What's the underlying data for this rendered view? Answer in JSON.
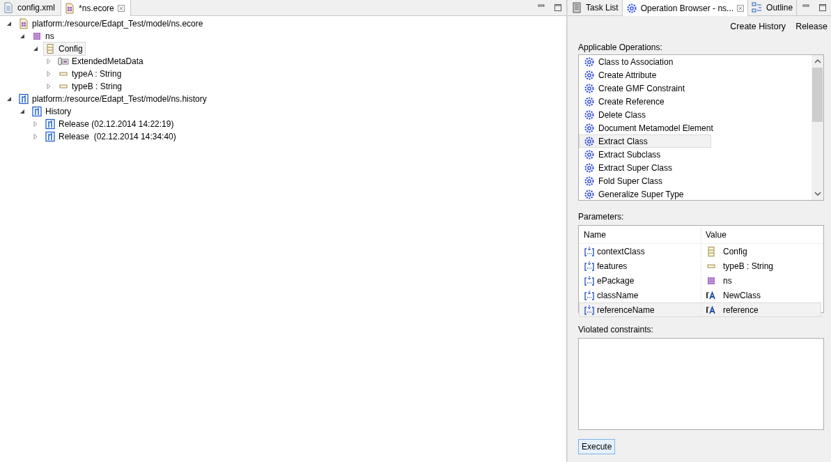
{
  "editor_tabs": [
    {
      "label": "config.xml",
      "kind": "xml",
      "selected": false,
      "closable": false
    },
    {
      "label": "*ns.ecore",
      "kind": "ecore",
      "selected": true,
      "closable": true
    }
  ],
  "tree": [
    {
      "label": "platform:/resource/Edapt_Test/model/ns.ecore",
      "kind": "resource",
      "expanded": true,
      "selected": false,
      "children": [
        {
          "label": "ns",
          "kind": "package",
          "expanded": true,
          "selected": false,
          "children": [
            {
              "label": "Config",
              "kind": "class",
              "expanded": true,
              "selected": true,
              "children": [
                {
                  "label": "ExtendedMetaData",
                  "kind": "annotation",
                  "expanded": false,
                  "selected": false
                },
                {
                  "label": "typeA : String",
                  "kind": "attribute",
                  "expanded": false,
                  "selected": false
                },
                {
                  "label": "typeB : String",
                  "kind": "attribute",
                  "expanded": false,
                  "selected": false
                }
              ]
            }
          ]
        }
      ]
    },
    {
      "label": "platform:/resource/Edapt_Test/model/ns.history",
      "kind": "history",
      "expanded": true,
      "selected": false,
      "children": [
        {
          "label": "History",
          "kind": "history",
          "expanded": true,
          "selected": false,
          "children": [
            {
              "label": "Release (02.12.2014 14:22:19)",
              "kind": "release",
              "expanded": false,
              "selected": false
            },
            {
              "label": "Release  (02.12.2014 14:34:40)",
              "kind": "release",
              "expanded": false,
              "selected": false
            }
          ]
        }
      ]
    }
  ],
  "view_tabs": [
    {
      "label": "Task List",
      "kind": "tasks",
      "selected": false
    },
    {
      "label": "Operation Browser - ns...",
      "kind": "gear",
      "selected": true
    },
    {
      "label": "Outline",
      "kind": "outline",
      "selected": false
    }
  ],
  "toolbar": [
    "Create History",
    "Release"
  ],
  "operations_label": "Applicable Operations:",
  "operations": [
    {
      "label": "Class to Association",
      "selected": false
    },
    {
      "label": "Create Attribute",
      "selected": false
    },
    {
      "label": "Create GMF Constraint",
      "selected": false
    },
    {
      "label": "Create Reference",
      "selected": false
    },
    {
      "label": "Delete Class",
      "selected": false
    },
    {
      "label": "Document Metamodel Element",
      "selected": false
    },
    {
      "label": "Extract Class",
      "selected": true
    },
    {
      "label": "Extract Subclass",
      "selected": false
    },
    {
      "label": "Extract Super Class",
      "selected": false
    },
    {
      "label": "Fold Super Class",
      "selected": false
    },
    {
      "label": "Generalize Super Type",
      "selected": false
    }
  ],
  "parameters_label": "Parameters:",
  "parameters": {
    "columns": [
      "Name",
      "Value"
    ],
    "rows": [
      {
        "name": "contextClass",
        "value": "Config",
        "kind": "class",
        "selected": false
      },
      {
        "name": "features",
        "value": "typeB : String",
        "kind": "attribute",
        "selected": false
      },
      {
        "name": "ePackage",
        "value": "ns",
        "kind": "package",
        "selected": false
      },
      {
        "name": "className",
        "value": "NewClass",
        "kind": "text",
        "selected": false
      },
      {
        "name": "referenceName",
        "value": "reference",
        "kind": "text",
        "selected": true
      }
    ]
  },
  "constraints_label": "Violated constraints:",
  "execute_button": "Execute"
}
